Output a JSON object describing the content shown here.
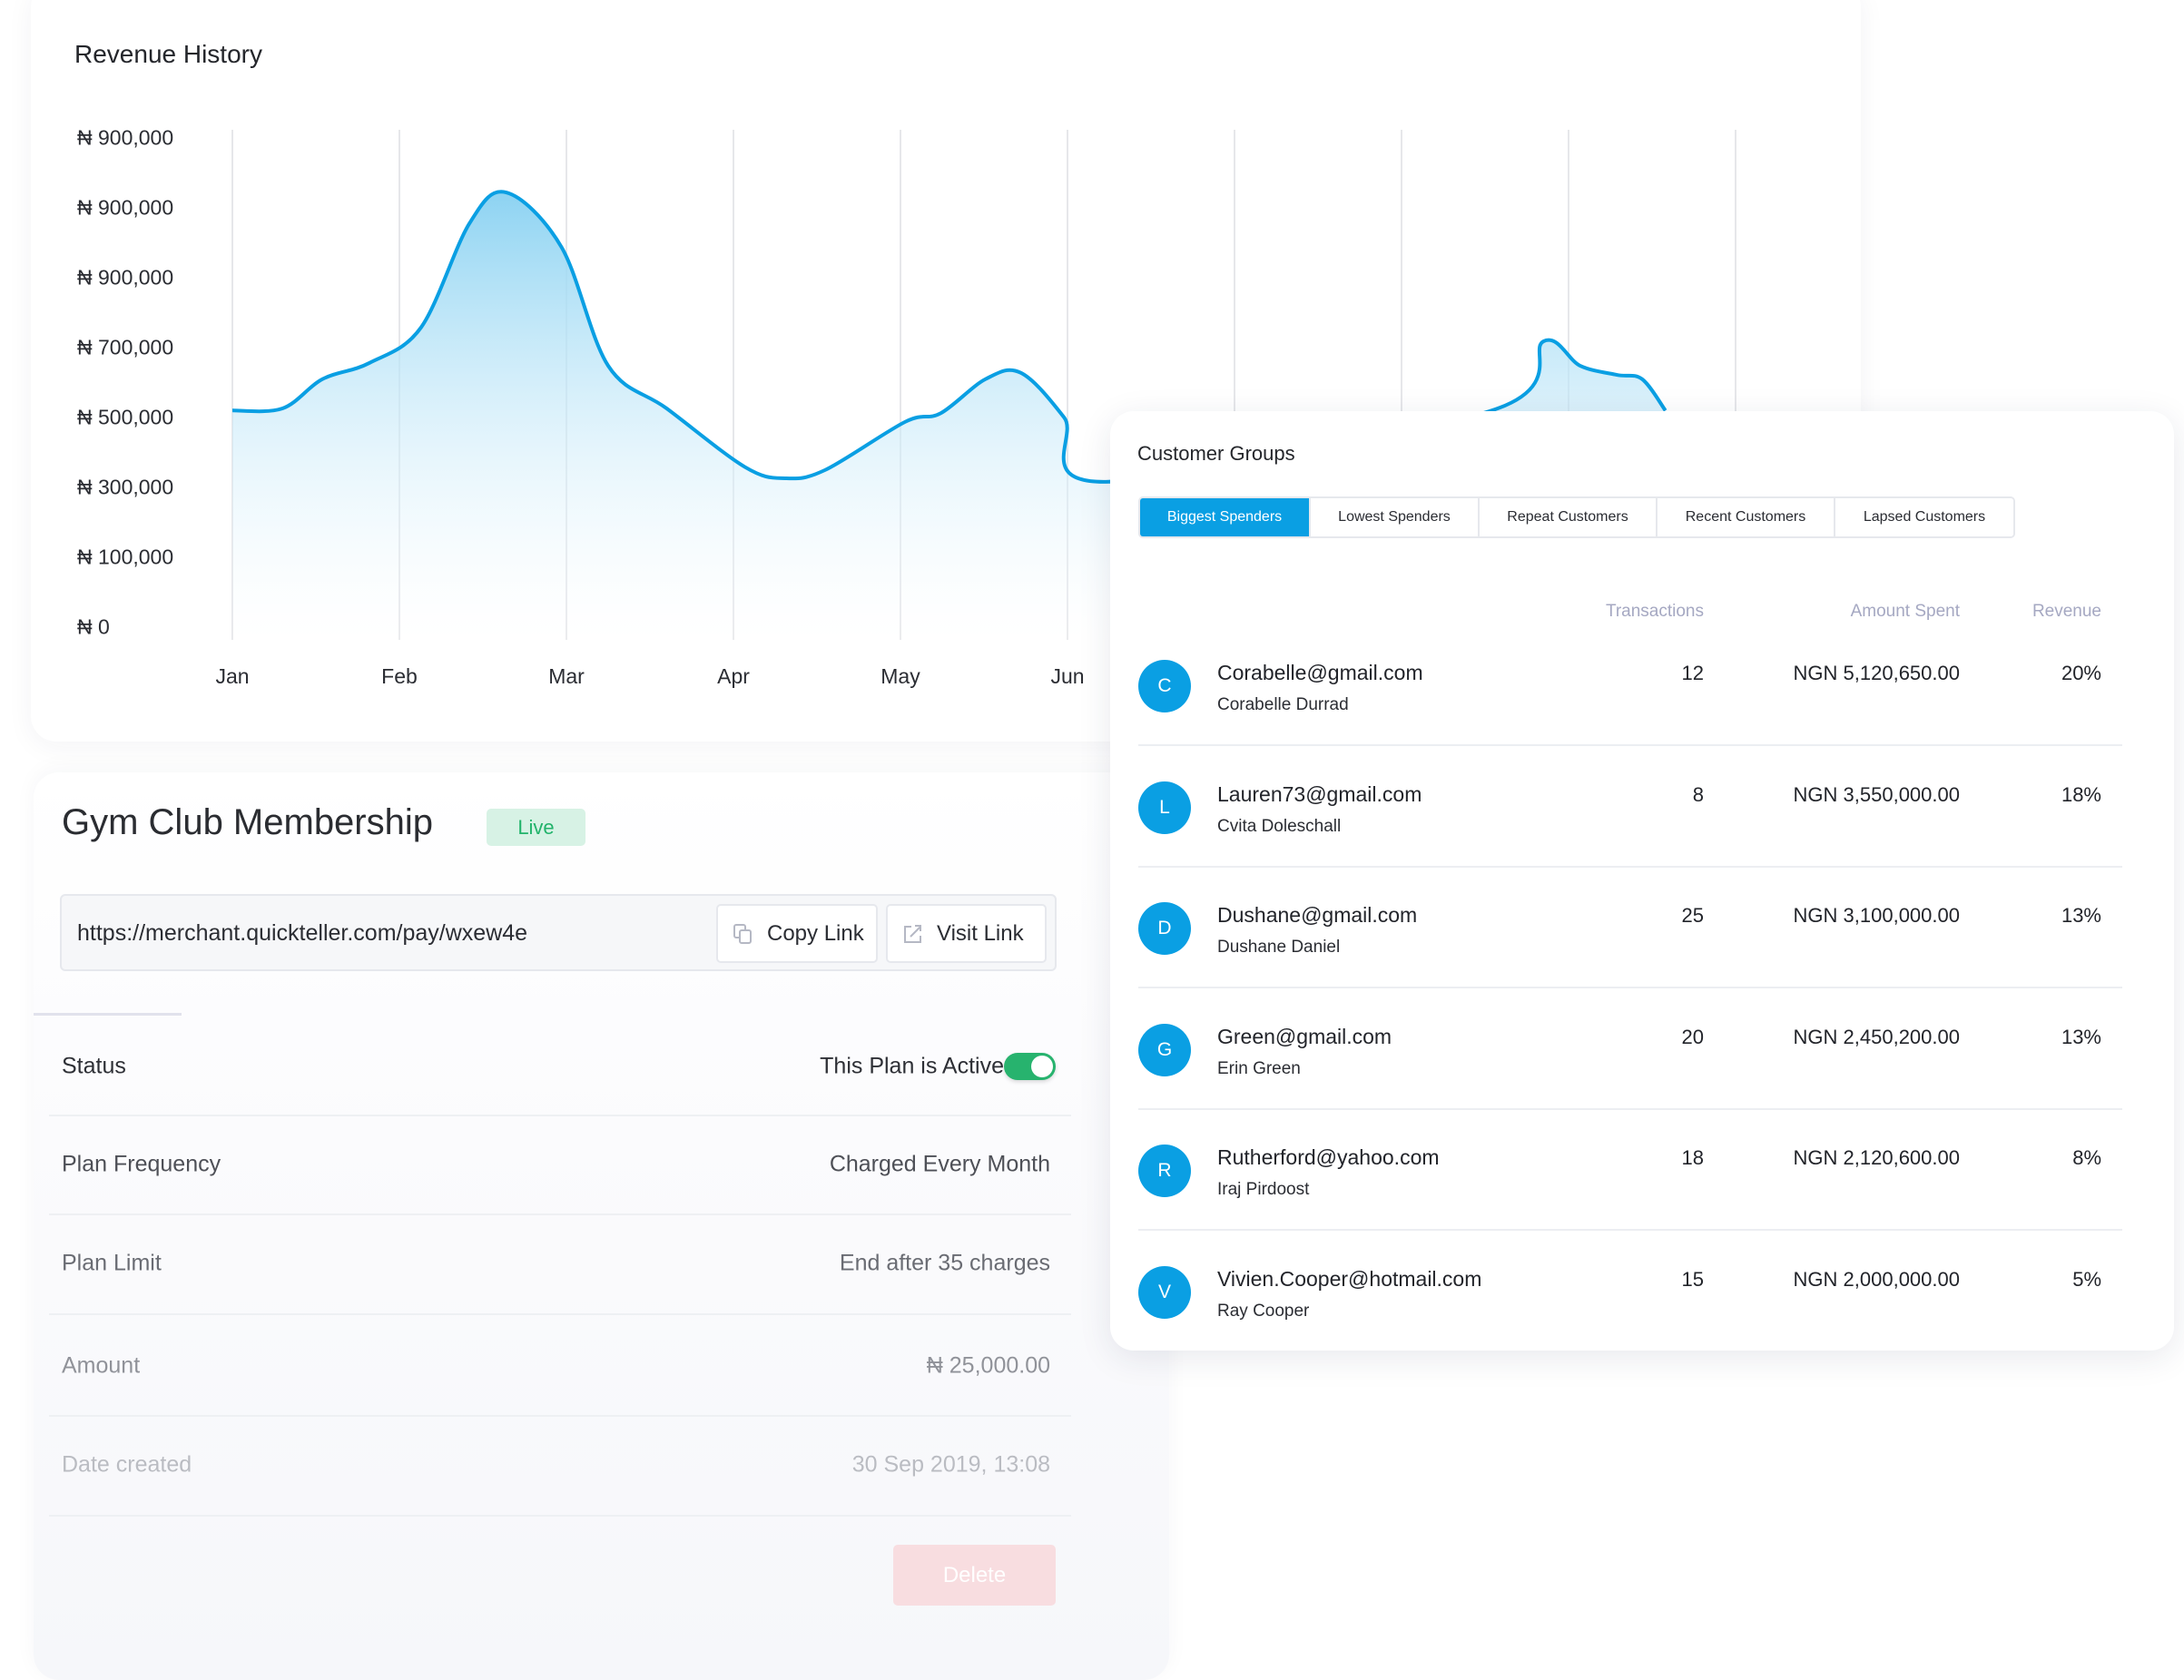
{
  "chart_data": {
    "type": "area",
    "title": "Revenue History",
    "y_tick_labels": [
      "₦ 900,000",
      "₦ 900,000",
      "₦ 900,000",
      "₦ 700,000",
      "₦ 500,000",
      "₦ 300,000",
      "₦ 100,000",
      "₦ 0"
    ],
    "x_tick_labels": [
      "Jan",
      "Feb",
      "Mar",
      "Apr",
      "May",
      "Jun"
    ],
    "x_gridline_count": 10,
    "grid": "vertical",
    "line_color": "#0a9fe3",
    "fill_color": "#8dd3f2",
    "series": [
      {
        "x_month": [
          1.0,
          1.3,
          1.54,
          1.82,
          2.13,
          2.42,
          2.64,
          2.97,
          3.25,
          3.6,
          4.07,
          4.31,
          4.55,
          5.03,
          5.24,
          5.51,
          5.72,
          5.98,
          6.23,
          8.54,
          8.85,
          9.07,
          9.29,
          9.44,
          9.58
        ],
        "y": [
          520000,
          526000,
          610000,
          656000,
          758000,
          1056000,
          1144000,
          988000,
          648000,
          526000,
          358000,
          326000,
          350000,
          488000,
          512000,
          610000,
          628000,
          500000,
          316000,
          520000,
          718000,
          648000,
          622000,
          610000,
          520000
        ]
      }
    ]
  },
  "plan": {
    "title": "Gym Club Membership",
    "badge": "Live",
    "url": "https://merchant.quickteller.com/pay/wxew4e",
    "copy_label": "Copy Link",
    "visit_label": "Visit Link",
    "rows": [
      {
        "label": "Status",
        "value": "This Plan is Active"
      },
      {
        "label": "Plan Frequency",
        "value": "Charged Every Month"
      },
      {
        "label": "Plan Limit",
        "value": "End after 35 charges"
      },
      {
        "label": "Amount",
        "value": "₦ 25,000.00"
      },
      {
        "label": "Date created",
        "value": "30 Sep 2019, 13:08"
      }
    ],
    "status_active": true,
    "delete_label": "Delete",
    "colors": {
      "toggle": "#27b36e",
      "badge_text": "#22b36b"
    }
  },
  "customers": {
    "title": "Customer Groups",
    "tabs": [
      "Biggest Spenders",
      "Lowest Spenders",
      "Repeat Customers",
      "Recent Customers",
      "Lapsed Customers"
    ],
    "active_tab": "Biggest Spenders",
    "columns": [
      "Transactions",
      "Amount Spent",
      "Revenue"
    ],
    "rows": [
      {
        "initial": "C",
        "email": "Corabelle@gmail.com",
        "name": "Corabelle Durrad",
        "transactions": "12",
        "amount": "NGN 5,120,650.00",
        "revenue": "20%"
      },
      {
        "initial": "L",
        "email": "Lauren73@gmail.com",
        "name": "Cvita Doleschall",
        "transactions": "8",
        "amount": "NGN 3,550,000.00",
        "revenue": "18%"
      },
      {
        "initial": "D",
        "email": "Dushane@gmail.com",
        "name": "Dushane Daniel",
        "transactions": "25",
        "amount": "NGN 3,100,000.00",
        "revenue": "13%"
      },
      {
        "initial": "G",
        "email": "Green@gmail.com",
        "name": "Erin Green",
        "transactions": "20",
        "amount": "NGN 2,450,200.00",
        "revenue": "13%"
      },
      {
        "initial": "R",
        "email": "Rutherford@yahoo.com",
        "name": "Iraj Pirdoost",
        "transactions": "18",
        "amount": "NGN 2,120,600.00",
        "revenue": "8%"
      },
      {
        "initial": "V",
        "email": "Vivien.Cooper@hotmail.com",
        "name": "Ray Cooper",
        "transactions": "15",
        "amount": "NGN 2,000,000.00",
        "revenue": "5%"
      }
    ],
    "accent": "#0a9fe3"
  }
}
